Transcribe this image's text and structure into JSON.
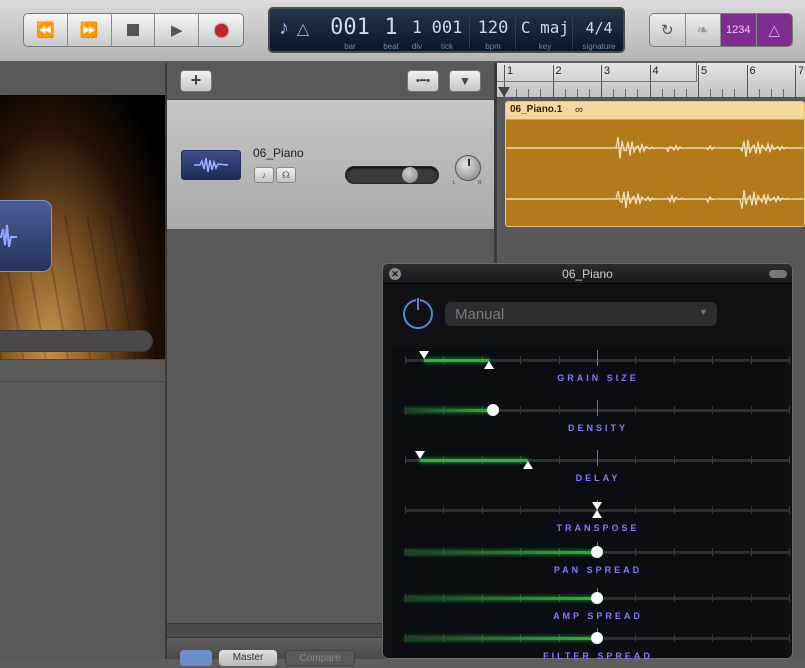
{
  "transport": {
    "rewind_icon": "rewind-icon",
    "forward_icon": "fast-forward-icon",
    "stop_icon": "stop-icon",
    "play_icon": "play-icon",
    "record_icon": "record-icon"
  },
  "lcd": {
    "bar": "001",
    "bar_label": "bar",
    "beat": "1",
    "beat_label": "beat",
    "div": "1",
    "div_label": "div",
    "tick": "001",
    "tick_label": "tick",
    "bpm": "120",
    "bpm_label": "bpm",
    "key": "C maj",
    "key_label": "key",
    "signature": "4/4",
    "signature_label": "signature"
  },
  "toolbar_right": {
    "count_in": "1234"
  },
  "track": {
    "name": "06_Piano"
  },
  "ruler": {
    "marks": [
      "1",
      "2",
      "3",
      "4",
      "5",
      "6",
      "7"
    ]
  },
  "region": {
    "name": "06_Piano.1",
    "color": "#b37a1c"
  },
  "plugin": {
    "title": "06_Piano",
    "preset": "Manual",
    "sliders": [
      {
        "label": "GRAIN SIZE",
        "type": "range",
        "min": 0.05,
        "max": 0.22
      },
      {
        "label": "DENSITY",
        "type": "value",
        "value": 0.23
      },
      {
        "label": "DELAY",
        "type": "range",
        "min": 0.04,
        "max": 0.32
      },
      {
        "label": "TRANSPOSE",
        "type": "center",
        "value": 0.5
      },
      {
        "label": "PAN SPREAD",
        "type": "value",
        "value": 0.5
      },
      {
        "label": "AMP SPREAD",
        "type": "value",
        "value": 0.5
      },
      {
        "label": "FILTER SPREAD",
        "type": "value",
        "value": 0.5
      }
    ]
  },
  "bottom_tabs": [
    "Master",
    "Compare"
  ]
}
